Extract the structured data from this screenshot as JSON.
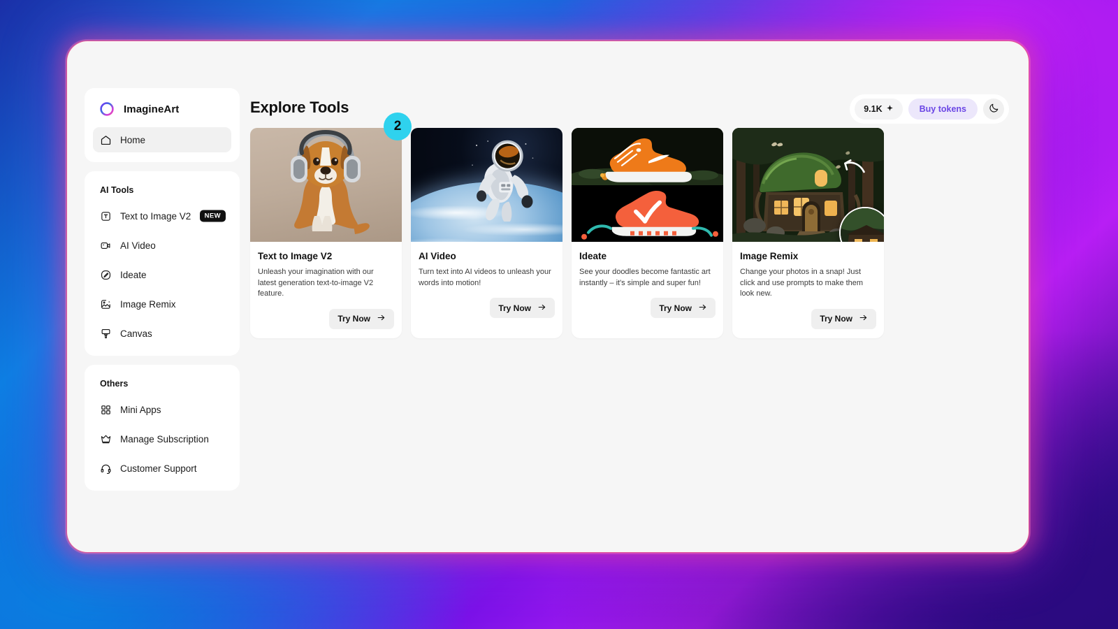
{
  "app": {
    "window_title": "ImagineArt"
  },
  "sidebar": {
    "brand": {
      "name": "ImagineArt",
      "logo_icon": "ring-gradient-logo"
    },
    "primary": [
      {
        "label": "Home",
        "icon": "home-icon",
        "active": true
      }
    ],
    "groups": [
      {
        "title": "AI Tools",
        "items": [
          {
            "label": "Text to Image V2",
            "icon": "text-box-icon",
            "badge": "NEW"
          },
          {
            "label": "AI Video",
            "icon": "video-camera-icon",
            "badge": ""
          },
          {
            "label": "Ideate",
            "icon": "pen-circle-icon",
            "badge": ""
          },
          {
            "label": "Image Remix",
            "icon": "image-edit-icon",
            "badge": ""
          },
          {
            "label": "Canvas",
            "icon": "brush-icon",
            "badge": ""
          }
        ]
      },
      {
        "title": "Others",
        "items": [
          {
            "label": "Mini Apps",
            "icon": "grid-apps-icon",
            "badge": ""
          },
          {
            "label": "Manage Subscription",
            "icon": "crown-icon",
            "badge": ""
          },
          {
            "label": "Customer Support",
            "icon": "headset-icon",
            "badge": ""
          }
        ]
      }
    ]
  },
  "header": {
    "page_title": "Explore Tools",
    "token_balance": "9.1K",
    "token_spark_icon": "sparkle-icon",
    "buy_tokens_label": "Buy tokens",
    "theme_toggle_icon": "moon-icon"
  },
  "cards": [
    {
      "title": "Text to Image V2",
      "description": "Unleash your imagination with our latest generation text-to-image V2 feature.",
      "cta": "Try Now",
      "cta_icon": "arrow-right-icon",
      "badge_count": "2",
      "thumbnail_alt": "dog-with-headphones"
    },
    {
      "title": "AI Video",
      "description": "Turn text into AI videos to unleash your words into motion!",
      "cta": "Try Now",
      "cta_icon": "arrow-right-icon",
      "badge_count": "",
      "thumbnail_alt": "astronaut-in-space"
    },
    {
      "title": "Ideate",
      "description": "See your doodles become fantastic art instantly – it's simple and super fun!",
      "cta": "Try Now",
      "cta_icon": "arrow-right-icon",
      "badge_count": "",
      "thumbnail_alt": "orange-sneaker-and-doodle"
    },
    {
      "title": "Image Remix",
      "description": "Change your photos in a snap! Just click and use prompts to make them look new.",
      "cta": "Try Now",
      "cta_icon": "arrow-right-icon",
      "badge_count": "",
      "thumbnail_alt": "forest-cottage-remix"
    }
  ],
  "colors": {
    "accent_purple": "#6b46e5",
    "badge_cyan": "#2fd2ee",
    "badge_new_bg": "#111111",
    "window_bg": "#f6f6f6",
    "card_bg": "#ffffff"
  }
}
